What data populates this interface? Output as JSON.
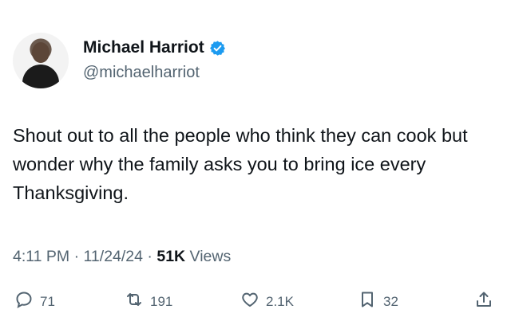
{
  "author": {
    "name": "Michael Harriot",
    "handle": "@michaelharriot"
  },
  "tweet": {
    "text": "Shout out to all the people who think they can cook but wonder why the family asks you to bring ice every Thanksgiving."
  },
  "meta": {
    "time": "4:11 PM",
    "date": "11/24/24",
    "views_count": "51K",
    "views_label": "Views"
  },
  "actions": {
    "replies": "71",
    "reposts": "191",
    "likes": "2.1K",
    "bookmarks": "32"
  },
  "colors": {
    "verified": "#1d9bf0",
    "text": "#0f1419",
    "secondary": "#536471"
  },
  "icons": [
    "verified-badge-icon",
    "reply-icon",
    "repost-icon",
    "like-icon",
    "bookmark-icon",
    "share-icon"
  ]
}
